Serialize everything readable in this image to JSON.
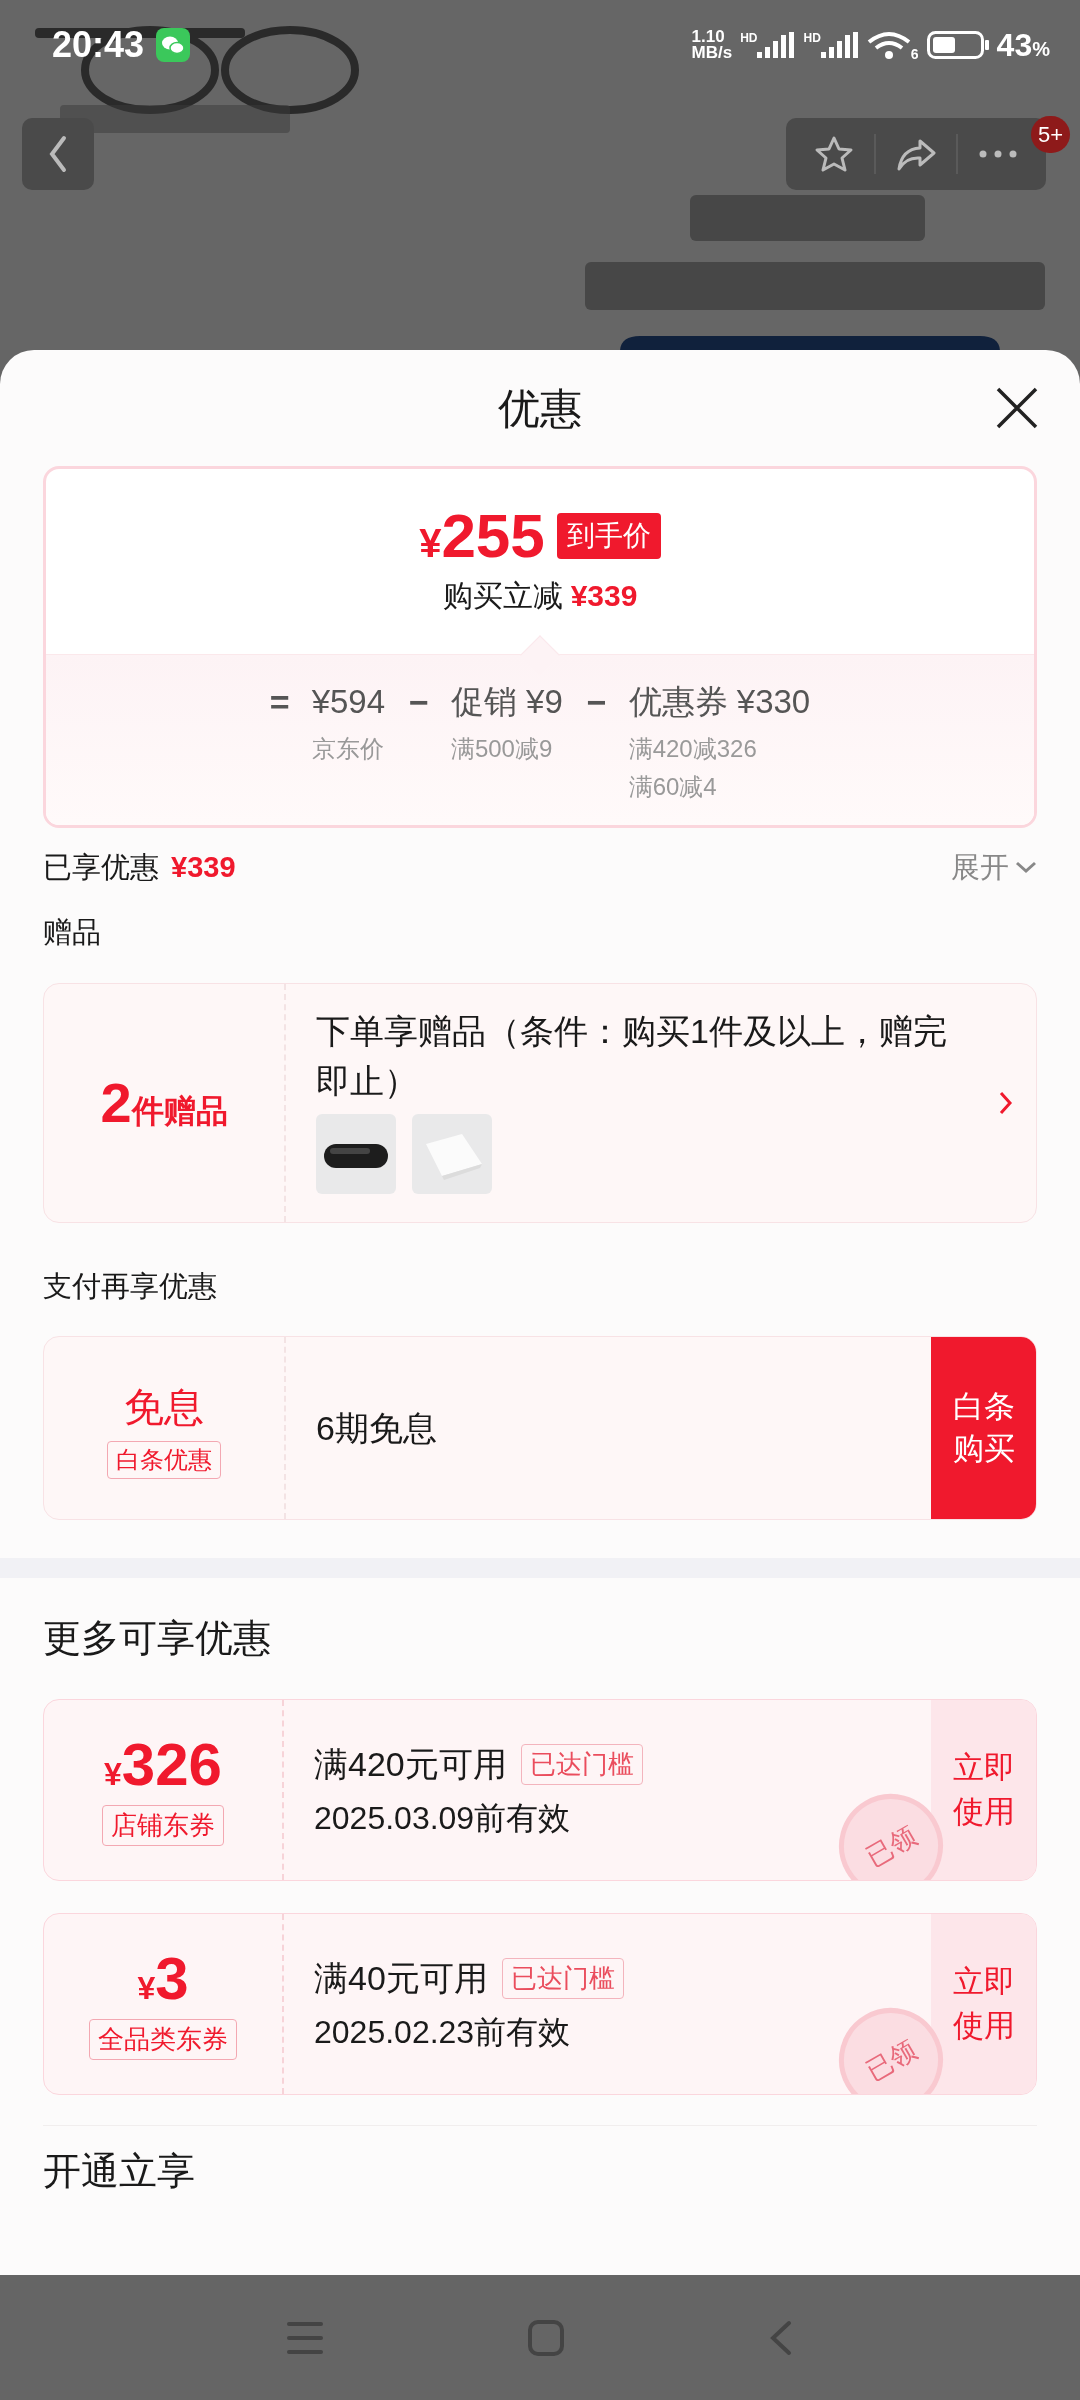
{
  "status_bar": {
    "time": "20:43",
    "speed": "1.10",
    "speed_unit": "MB/s",
    "signal_labels": [
      "HD",
      "HD"
    ],
    "wifi_label": "6",
    "battery": "43",
    "battery_unit": "%"
  },
  "header": {
    "badge": "5+"
  },
  "sheet": {
    "title": "优惠"
  },
  "price_summary": {
    "currency": "¥",
    "final_price": "255",
    "final_label": "到手价",
    "saving_label": "购买立减",
    "saving": "¥339",
    "breakdown": [
      {
        "operator": "=",
        "amount": "¥594",
        "notes": [
          "京东价"
        ]
      },
      {
        "operator": "−",
        "label": "促销",
        "amount": "¥9",
        "notes": [
          "满500减9"
        ]
      },
      {
        "operator": "−",
        "label": "优惠券",
        "amount": "¥330",
        "notes": [
          "满420减326",
          "满60减4"
        ]
      }
    ]
  },
  "enjoyed": {
    "label": "已享优惠",
    "amount": "¥339",
    "toggle": "展开",
    "expanded": false
  },
  "gifts": {
    "heading": "赠品",
    "count": "2",
    "count_unit": "件赠品",
    "description": "下单享赠品（条件：购买1件及以上，赠完即止）"
  },
  "payment": {
    "heading": "支付再享优惠",
    "offers": [
      {
        "title": "免息",
        "tag": "白条优惠",
        "description": "6期免息",
        "action": "白条购买"
      }
    ]
  },
  "more": {
    "heading": "更多可享优惠",
    "coupons": [
      {
        "currency": "¥",
        "amount": "326",
        "type": "店铺东券",
        "condition": "满420元可用",
        "status_tag": "已达门槛",
        "validity": "2025.03.09前有效",
        "action": "立即使用",
        "claimed": true,
        "stamp": "已领"
      },
      {
        "currency": "¥",
        "amount": "3",
        "type": "全品类东券",
        "condition": "满40元可用",
        "status_tag": "已达门槛",
        "validity": "2025.02.23前有效",
        "action": "立即使用",
        "claimed": true,
        "stamp": "已领"
      }
    ]
  },
  "next_section": {
    "heading": "开通立享"
  }
}
